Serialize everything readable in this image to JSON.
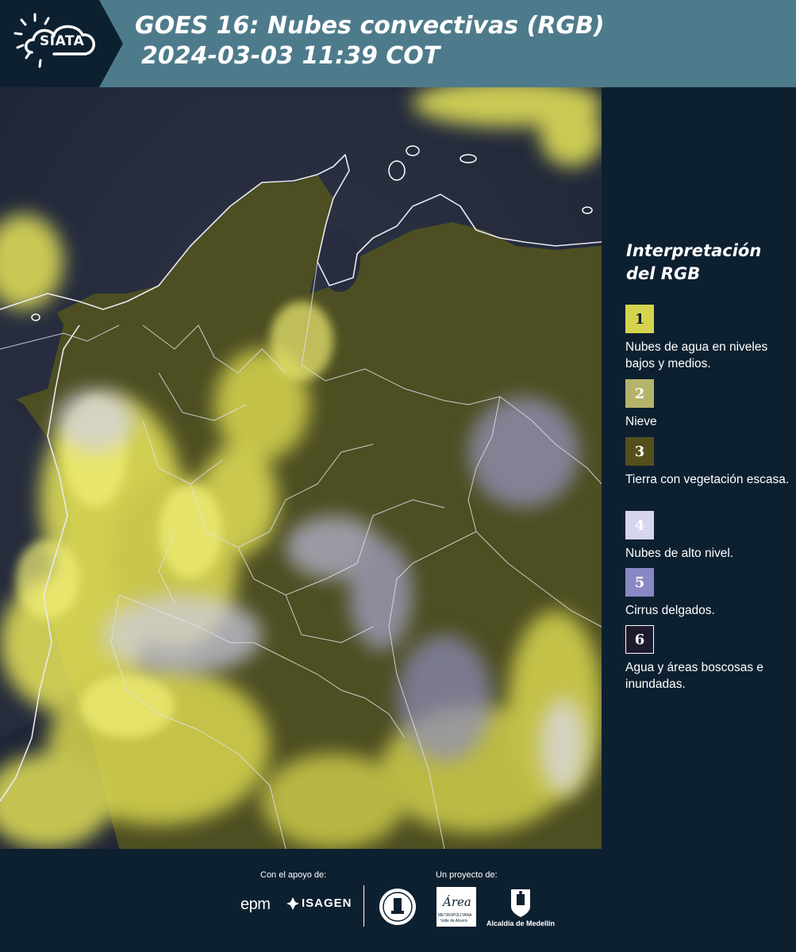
{
  "header": {
    "logo_text": "SIATA",
    "title_line1": "GOES 16: Nubes convectivas (RGB)",
    "title_line2": "2024-03-03 11:39 COT",
    "background_color": "#4e7b8b",
    "logo_background_color": "#0d2030"
  },
  "legend": {
    "title_line1": "Interpretación",
    "title_line2": "del RGB",
    "items": [
      {
        "number": "1",
        "label": "Nubes de agua en niveles bajos y medios.",
        "color": "#d6d44d"
      },
      {
        "number": "2",
        "label": "Nieve",
        "color": "#b5b46b"
      },
      {
        "number": "3",
        "label": "Tierra con vegetación escasa.",
        "color": "#54501b"
      },
      {
        "number": "4",
        "label": "Nubes de alto nivel.",
        "color": "#d6d4ee"
      },
      {
        "number": "5",
        "label": "Cirrus delgados.",
        "color": "#8a88c4"
      },
      {
        "number": "6",
        "label": "Agua y áreas boscosas e inundadas.",
        "color": "#1c1a2c"
      }
    ]
  },
  "footer": {
    "support_label": "Con el apoyo de:",
    "project_label": "Un proyecto de:",
    "epm_text": "epm",
    "isagen_text": "ISAGEN",
    "area_script": "Área",
    "area_line1": "METROPOLITANA",
    "area_line2": "Valle de Aburrá",
    "alcaldia_text": "Alcaldía de Medellín"
  },
  "map": {
    "land_color": "#4f5122",
    "ocean_color": "#252c3d",
    "cloud_color": "#e8e65a",
    "high_cloud_color": "#cfcde6",
    "border_color": "#e9e9ef"
  }
}
